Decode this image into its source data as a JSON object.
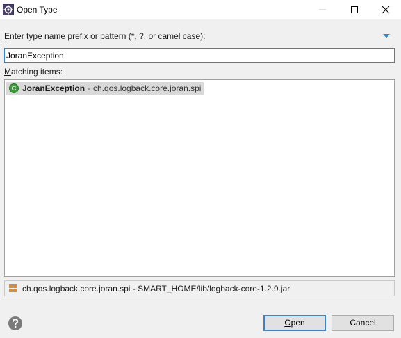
{
  "window": {
    "title": "Open Type",
    "app_icon": "eclipse-gear-icon"
  },
  "prompt": {
    "accesskey": "E",
    "label_rest": "nter type name prefix or pattern (*, ?, or camel case):"
  },
  "search": {
    "value": "JoranException"
  },
  "matching": {
    "accesskey": "M",
    "label_rest": "atching items:"
  },
  "results": [
    {
      "icon": "class-icon",
      "icon_letter": "C",
      "type_name": "JoranException",
      "separator": "-",
      "package": "ch.qos.logback.core.joran.spi",
      "selected": true
    }
  ],
  "details": {
    "icon": "package-icon",
    "text": "ch.qos.logback.core.joran.spi - SMART_HOME/lib/logback-core-1.2.9.jar"
  },
  "buttons": {
    "open_accesskey": "O",
    "open_rest": "pen",
    "cancel": "Cancel"
  },
  "colors": {
    "accent": "#3b83c4",
    "class_icon": "#3e9b3a",
    "package_icon": "#e08a2c",
    "selection": "#d9d9d9"
  }
}
